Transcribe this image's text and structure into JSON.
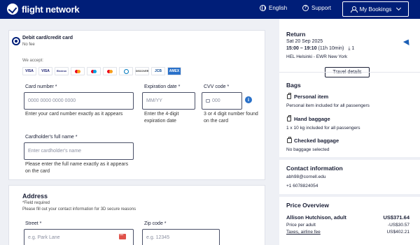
{
  "header": {
    "brand": "flight network",
    "language": "English",
    "support": "Support",
    "bookings": "My Bookings"
  },
  "payment": {
    "method_title": "Debit card/credit card",
    "method_fee": "No fee",
    "we_accept": "We accept:",
    "accepted_cards": [
      "VISA",
      "VISA",
      "Electron",
      "MC",
      "Maestro",
      "MC",
      "Diners",
      "DISCOVER",
      "JCB",
      "AMEX"
    ],
    "card_number": {
      "label": "Card number *",
      "placeholder": "0000 0000 0000 0000",
      "help": "Enter your card number exactly as it appears"
    },
    "expiration": {
      "label": "Expiration date *",
      "placeholder": "MM/YY",
      "help": "Enter the 4-digit expiration date"
    },
    "cvv": {
      "label": "CVV code *",
      "placeholder": "000",
      "help": "3 or 4 digit number found on the card"
    },
    "holder": {
      "label": "Cardholder's full name *",
      "placeholder": "Enter cardholder's name",
      "help": "Please enter the full name exactly as it appears on the card"
    }
  },
  "address": {
    "title": "Address",
    "required_note": "*Field required",
    "info_note": "Please fill out your contact information for 3D secure reasons",
    "street": {
      "label": "Street *",
      "placeholder": "e.g. Park Lane"
    },
    "zip": {
      "label": "Zip code *",
      "placeholder": "e.g. 12345"
    }
  },
  "sidebar": {
    "return": {
      "title": "Return",
      "date": "Sat 20 Sep 2025",
      "times": "15:00 – 19:10",
      "duration": "(11h 10min)",
      "stops": "1",
      "route": "HEL Helsinki - EWR New York",
      "details_button": "Travel details"
    },
    "bags": {
      "title": "Bags",
      "personal_title": "Personal item",
      "personal_desc": "Personal item included for all passengers",
      "hand_title": "Hand baggage",
      "hand_desc": "1 x 10 kg included for all passengers",
      "checked_title": "Checked baggage",
      "checked_desc": "No baggage selected"
    },
    "contact": {
      "title": "Contact information",
      "email": "abh98@cornell.edu",
      "phone": "+1 6078824054"
    },
    "price": {
      "title": "Price Overview",
      "passenger": "Allison Hutchison, adult",
      "passenger_total": "US$371.64",
      "per_adult_label": "Price per adult",
      "per_adult_value": "-US$30.57",
      "taxes_label": "Taxes, airline fee",
      "taxes_value": "US$402.21"
    }
  }
}
